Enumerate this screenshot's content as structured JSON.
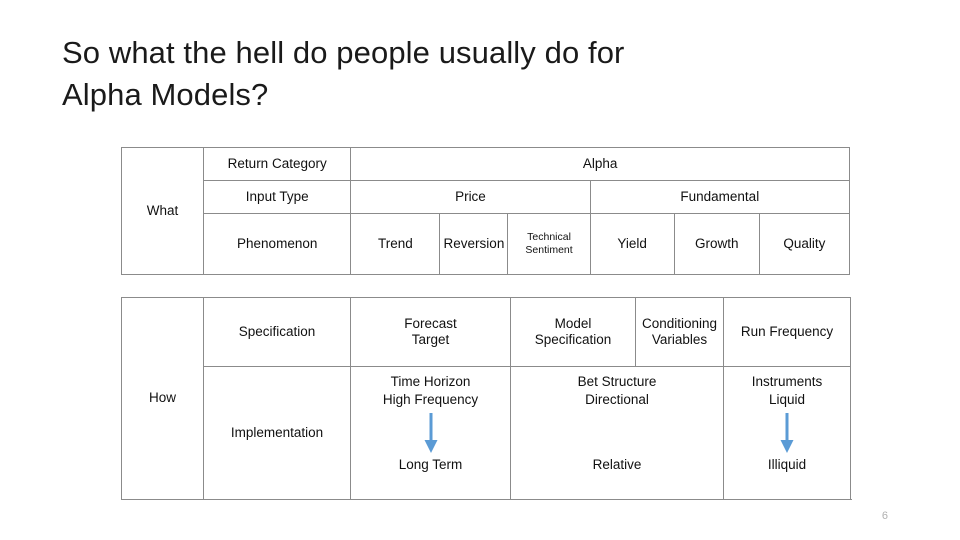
{
  "slide": {
    "title": "So what the hell do people usually do for\nAlpha Models?",
    "page_number": "6",
    "arrow_color": "#5B9BD5",
    "border_color": "#8b8b8b"
  },
  "what_table": {
    "row_label": "What",
    "rows": [
      {
        "name": "return-category",
        "label": "Return Category",
        "cells": [
          {
            "text": "Alpha",
            "span": 6
          }
        ]
      },
      {
        "name": "input-type",
        "label": "Input Type",
        "cells": [
          {
            "text": "Price",
            "span": 3
          },
          {
            "text": "Fundamental",
            "span": 3
          }
        ]
      },
      {
        "name": "phenomenon",
        "label": "Phenomenon",
        "cells": [
          {
            "text": "Trend",
            "span": 1
          },
          {
            "text": "Reversion",
            "span": 1
          },
          {
            "text": "Technical\nSentiment",
            "span": 1,
            "small": true
          },
          {
            "text": "Yield",
            "span": 1
          },
          {
            "text": "Growth",
            "span": 1
          },
          {
            "text": "Quality",
            "span": 1
          }
        ]
      }
    ]
  },
  "how_table": {
    "row_label": "How",
    "specification": {
      "label": "Specification",
      "cells": [
        {
          "text": "Forecast\nTarget"
        },
        {
          "text": "Model\nSpecification"
        },
        {
          "text": "Conditioning\nVariables"
        },
        {
          "text": "Run Frequency"
        }
      ]
    },
    "implementation": {
      "label": "Implementation",
      "cells": [
        {
          "top": "Time Horizon\nHigh Frequency",
          "arrow": true,
          "bottom": "Long Term"
        },
        {
          "top": "Bet Structure\nDirectional",
          "arrow": false,
          "bottom": "Relative"
        },
        {
          "top": "Instruments\nLiquid",
          "arrow": true,
          "bottom": "Illiquid"
        }
      ]
    }
  }
}
